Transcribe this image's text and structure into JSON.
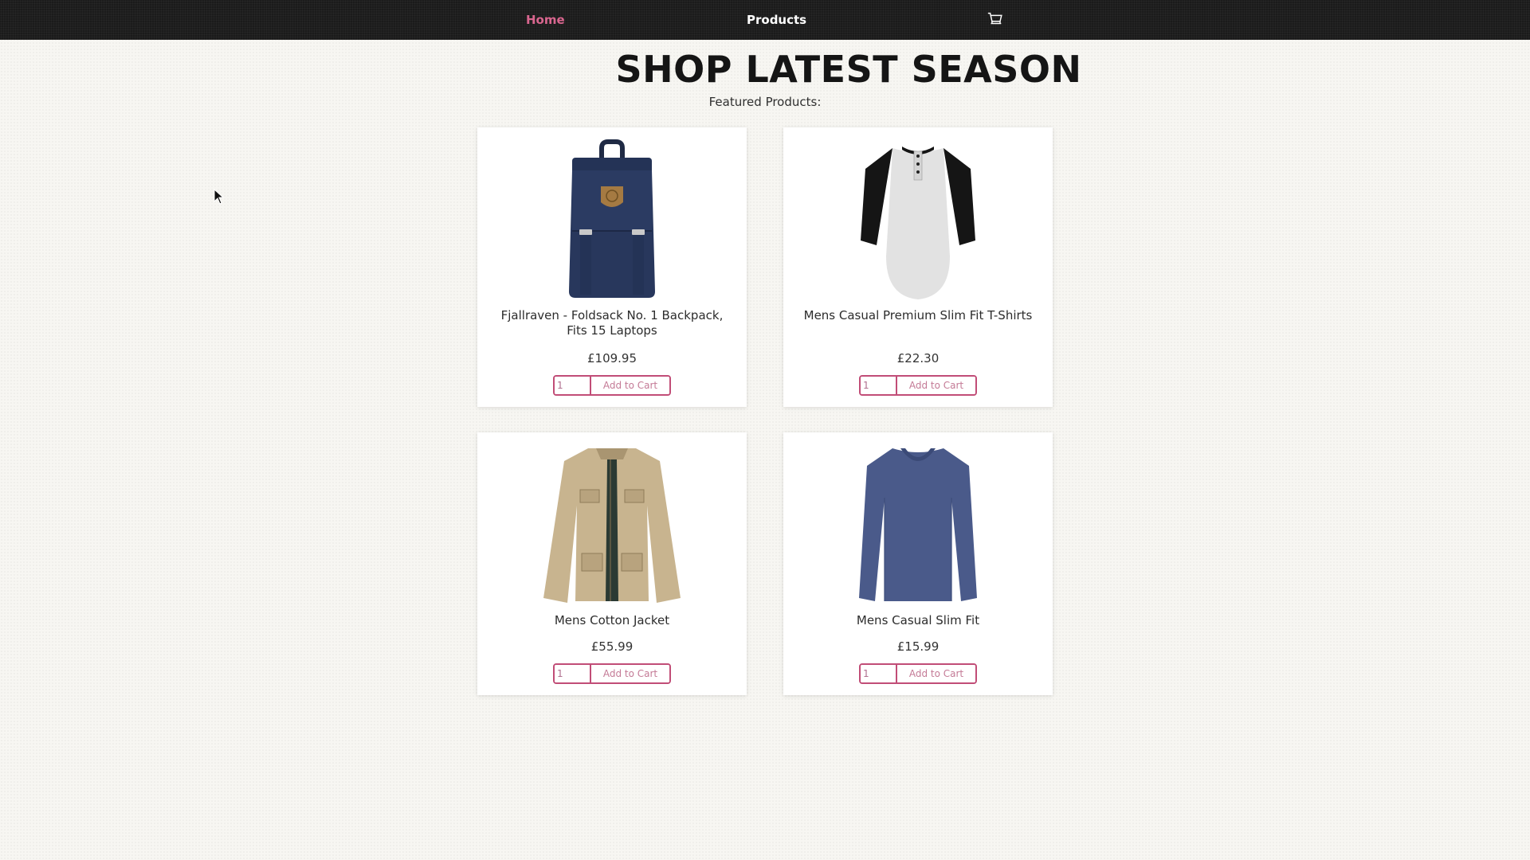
{
  "nav": {
    "home_label": "Home",
    "products_label": "Products",
    "cart_icon": "cart-icon",
    "active_color": "#d9668f"
  },
  "hero": {
    "title": "SHOP LATEST SEASON",
    "subtitle": "Featured Products:"
  },
  "products": [
    {
      "name": "Fjallraven - Foldsack No. 1 Backpack, Fits 15 Laptops",
      "price": "£109.95",
      "qty": "1",
      "add_label": "Add to Cart",
      "image": "backpack-image"
    },
    {
      "name": "Mens Casual Premium Slim Fit T-Shirts",
      "price": "£22.30",
      "qty": "1",
      "add_label": "Add to Cart",
      "image": "raglan-tshirt-image"
    },
    {
      "name": "Mens Cotton Jacket",
      "price": "£55.99",
      "qty": "1",
      "add_label": "Add to Cart",
      "image": "cotton-jacket-image"
    },
    {
      "name": "Mens Casual Slim Fit",
      "price": "£15.99",
      "qty": "1",
      "add_label": "Add to Cart",
      "image": "longsleeve-tshirt-image"
    }
  ],
  "colors": {
    "accent": "#c14d77",
    "navbar": "#1b1b1b",
    "background": "#f7f6f2"
  }
}
